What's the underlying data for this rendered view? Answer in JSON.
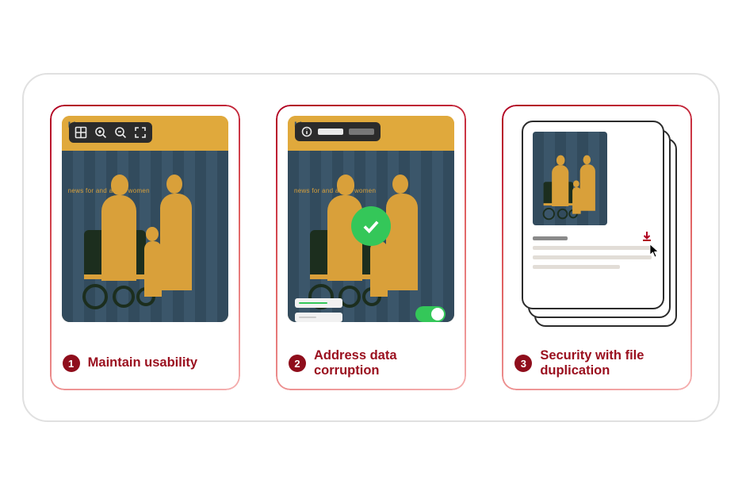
{
  "cover": {
    "title": "Up",
    "subline": "news for and about women"
  },
  "cards": [
    {
      "num": "1",
      "label": "Maintain usability"
    },
    {
      "num": "2",
      "label": "Address data corruption"
    },
    {
      "num": "3",
      "label": "Security with file duplication"
    }
  ],
  "icons": {
    "grid": "grid-icon",
    "zoom_in": "zoom-in-icon",
    "zoom_out": "zoom-out-icon",
    "fullscreen": "fullscreen-icon",
    "info": "info-icon",
    "check": "check-icon",
    "toggle": "toggle-on",
    "download": "download-icon",
    "cursor": "cursor-icon"
  }
}
